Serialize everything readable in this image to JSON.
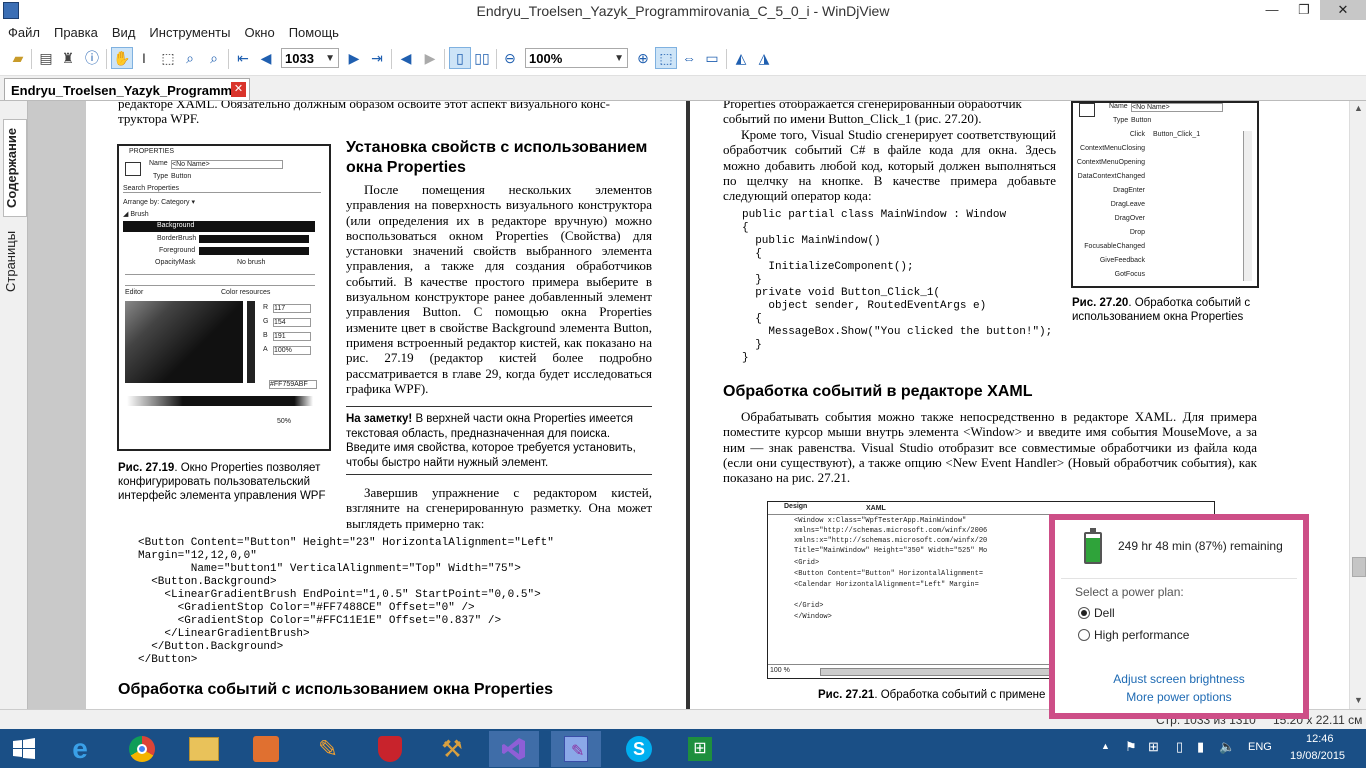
{
  "window": {
    "title": "Endryu_Troelsen_Yazyk_Programmirovania_C_5_0_i - WinDjView",
    "minimize": "—",
    "restore": "❐",
    "close": "✕"
  },
  "menu": [
    "Файл",
    "Правка",
    "Вид",
    "Инструменты",
    "Окно",
    "Помощь"
  ],
  "toolbar": {
    "page_number": "1033",
    "zoom": "100%"
  },
  "tab": {
    "label": "Endryu_Troelsen_Yazyk_Programmi...",
    "close": "✕"
  },
  "sidebar": {
    "contents_tab": "Содержание",
    "pages_tab": "Страницы"
  },
  "left_page": {
    "top_fragment_1": "редакторе XAML. Обязательно должным образом освойте этот аспект визуального конс-",
    "top_fragment_2": "труктора WPF.",
    "heading_1": "Установка свойств с использованием окна Properties",
    "para_1": "После помещения нескольких элементов управления на поверхность визуального конструктора (или определения их в редакторе вручную) можно воспользоваться окном Properties (Свойства) для установки значений свойств выбранного элемента управления, а также для создания обработчиков событий. В качестве простого примера выберите в визуальном конструкторе ранее добавленный элемент управления Button. С помощью окна Properties измените цвет в свойстве Background элемента Button, применя встроенный редактор кистей, как показано на рис. 27.19 (редактор кистей более подробно рассматривается в главе 29, когда будет исследоваться графика WPF).",
    "note_label": "На заметку!",
    "note_text": "В верхней части окна Properties имеется текстовая область, предназначенная для поиска. Введите имя свойства, которое требуется установить, чтобы быстро найти нужный элемент.",
    "caption_label": "Рис. 27.19",
    "caption_text": ". Окно Properties позволяет конфигурировать пользовательский интерфейс элемента управления WPF",
    "para_2": "Завершив упражнение с редактором кистей, взгляните на сгенерированную разметку. Она может выглядеть примерно так:",
    "code": "<Button Content=\"Button\" Height=\"23\" HorizontalAlignment=\"Left\"\nMargin=\"12,12,0,0\"\n        Name=\"button1\" VerticalAlignment=\"Top\" Width=\"75\">\n  <Button.Background>\n    <LinearGradientBrush EndPoint=\"1,0.5\" StartPoint=\"0,0.5\">\n      <GradientStop Color=\"#FF7488CE\" Offset=\"0\" />\n      <GradientStop Color=\"#FFC11E1E\" Offset=\"0.837\" />\n    </LinearGradientBrush>\n  </Button.Background>\n</Button>",
    "heading_2": "Обработка событий с использованием окна Properties",
    "figure": {
      "header": "PROPERTIES",
      "name_label": "Name",
      "name_value": "<No Name>",
      "type_label": "Type",
      "type_value": "Button",
      "search": "Search Properties",
      "arrange": "Arrange by: Category ▾",
      "brush": "◢ Brush",
      "rows": [
        "Background",
        "BorderBrush",
        "Foreground",
        "OpacityMask"
      ],
      "opacity_value": "No brush",
      "editor": "Editor",
      "color_resources": "Color resources",
      "r": "R",
      "r_val": "117",
      "g": "G",
      "g_val": "154",
      "b": "B",
      "b_val": "191",
      "a": "A",
      "a_val": "100%",
      "hex": "#FF759ABF",
      "pct": "50%"
    }
  },
  "right_page": {
    "top_fragment_1": "Properties отображается сгенерированный обработчик",
    "top_fragment_2": "событий по имени Button_Click_1 (рис. 27.20).",
    "para_1": "Кроме того, Visual Studio сгенерирует соответствующий обработчик событий C# в файле кода для окна. Здесь можно добавить любой код, который должен выполняться по щелчку на кнопке. В качестве примера добавьте следующий оператор кода:",
    "code": "public partial class MainWindow : Window\n{\n  public MainWindow()\n  {\n    InitializeComponent();\n  }\n  private void Button_Click_1(\n    object sender, RoutedEventArgs e)\n  {\n    MessageBox.Show(\"You clicked the button!\");\n  }\n}",
    "caption_label": "Рис. 27.20",
    "caption_text": ". Обработка событий с использованием окна Properties",
    "heading": "Обработка событий в редакторе XAML",
    "para_2": "Обрабатывать события можно также непосредственно в редакторе XAML. Для примера поместите курсор мыши внутрь элемента <Window> и введите имя события MouseMove, а за ним — знак равенства. Visual Studio отобразит все совместимые обработчики из файла кода (если они существуют), а также опцию <New Event Handler> (Новый обработчик события), как показано на рис. 27.21.",
    "caption2_label": "Рис. 27.21",
    "caption2_text": ". Обработка событий с примене",
    "fig20": {
      "name_label": "Name",
      "name_value": "<No Name>",
      "type_label": "Type",
      "type_value": "Button",
      "events": [
        "Click",
        "ContextMenuClosing",
        "ContextMenuOpening",
        "DataContextChanged",
        "DragEnter",
        "DragLeave",
        "DragOver",
        "Drop",
        "FocusableChanged",
        "GiveFeedback",
        "GotFocus"
      ],
      "click_value": "Button_Click_1"
    },
    "fig21": {
      "design_tab": "Design",
      "xaml_tab": "XAML",
      "zoom": "100 %",
      "lines": [
        "<Window x:Class=\"WpfTesterApp.MainWindow\"",
        "        xmlns=\"http://schemas.microsoft.com/winfx/2006",
        "        xmlns:x=\"http://schemas.microsoft.com/winfx/20",
        "        Title=\"MainWindow\" Height=\"350\" Width=\"525\" Mo",
        "    <Grid>",
        "        <Button Content=\"Button\" HorizontalAlignment=",
        "        <Calendar HorizontalAlignment=\"Left\" Margin=",
        "",
        "    </Grid>",
        "</Window>"
      ]
    }
  },
  "status": {
    "page_info": "Стр. 1033 из 1310",
    "page_size": "15.20 x 22.11 см"
  },
  "power": {
    "remaining": "249 hr 48 min (87%) remaining",
    "battery_level": 0.87,
    "plan_label": "Select a power plan:",
    "plans": [
      "Dell",
      "High performance"
    ],
    "selected_plan": "Dell",
    "brightness_link": "Adjust screen brightness",
    "more_link": "More power options"
  },
  "taskbar": {
    "lang": "ENG",
    "time": "12:46",
    "date": "19/08/2015",
    "apps": [
      "start-button",
      "internet-explorer-icon",
      "chrome-icon",
      "file-explorer-icon",
      "photo-app-icon",
      "tools-app-icon",
      "security-app-icon",
      "build-tools-icon",
      "visual-studio-icon",
      "windjview-icon",
      "skype-icon",
      "excel-icon"
    ]
  },
  "colors": {
    "taskbar": "#1a4f86",
    "popup_border": "#cd4e87",
    "link": "#1e6ab3"
  }
}
